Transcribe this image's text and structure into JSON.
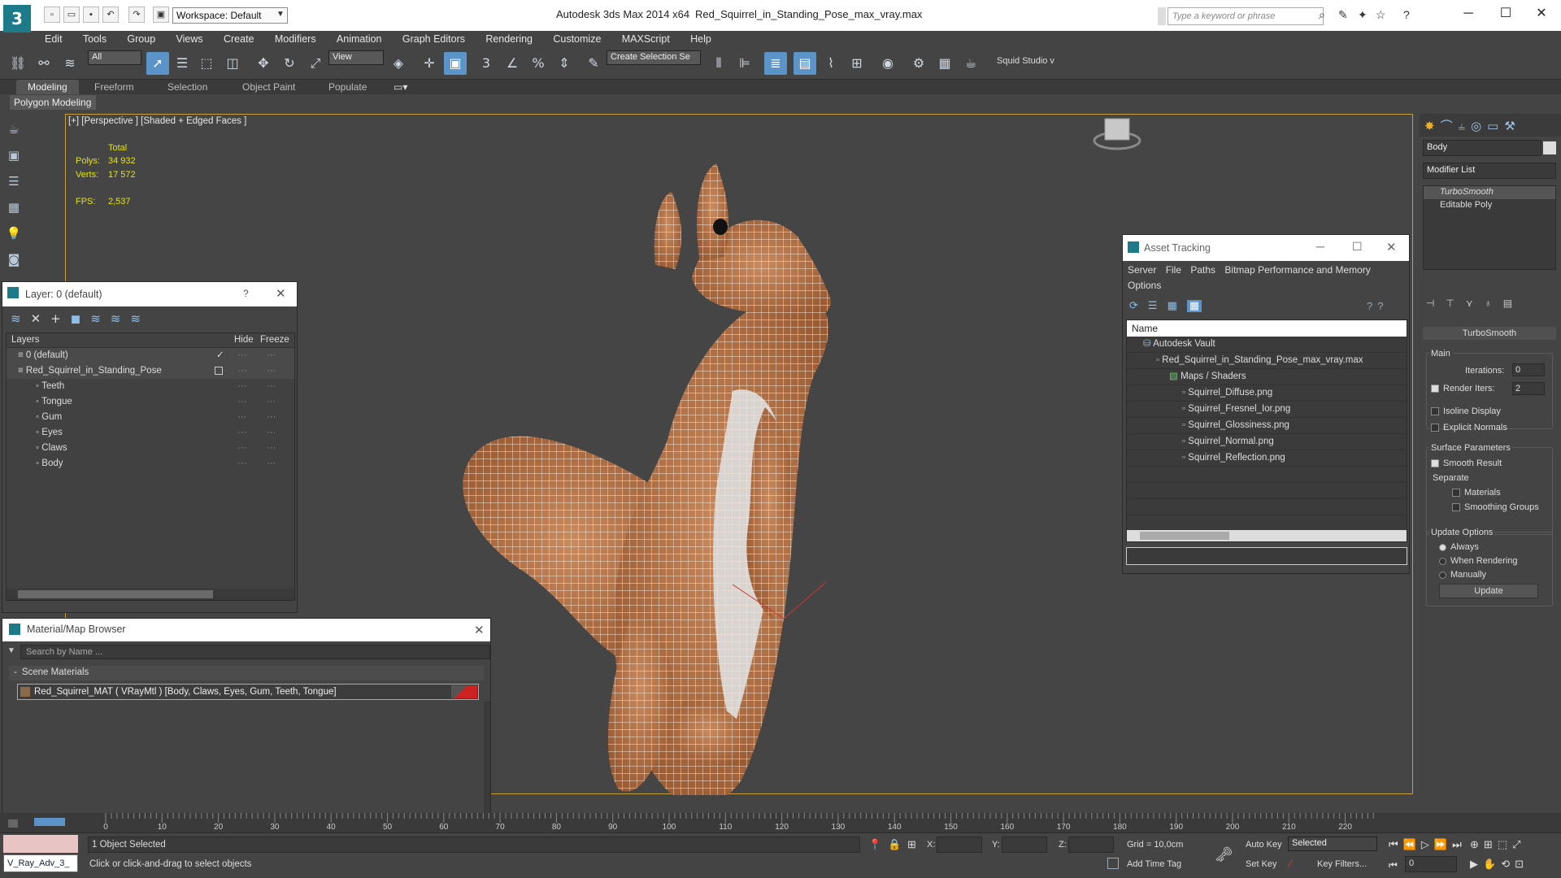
{
  "app": {
    "title": "Autodesk 3ds Max  2014 x64",
    "file": "Red_Squirrel_in_Standing_Pose_max_vray.max",
    "workspace": "Workspace: Default",
    "search_placeholder": "Type a keyword or phrase"
  },
  "menu": [
    "Edit",
    "Tools",
    "Group",
    "Views",
    "Create",
    "Modifiers",
    "Animation",
    "Graph Editors",
    "Rendering",
    "Customize",
    "MAXScript",
    "Help"
  ],
  "toolbar": {
    "filter": "All",
    "ref_coord": "View",
    "selection_set": "Create Selection Se",
    "squid": "Squid Studio v"
  },
  "ribbon": {
    "tabs": [
      "Modeling",
      "Freeform",
      "Selection",
      "Object Paint",
      "Populate"
    ],
    "sub": "Polygon Modeling"
  },
  "viewport": {
    "label": "[+] [Perspective ] [Shaded + Edged Faces ]",
    "stats": {
      "total": "Total",
      "polys_label": "Polys:",
      "polys": "34 932",
      "verts_label": "Verts:",
      "verts": "17 572",
      "fps_label": "FPS:",
      "fps": "2,537"
    }
  },
  "layer_dialog": {
    "title": "Layer: 0 (default)",
    "help": "?",
    "col_layers": "Layers",
    "col_hide": "Hide",
    "col_freeze": "Freeze",
    "rows": [
      {
        "name": "0 (default)",
        "indent": 0
      },
      {
        "name": "Red_Squirrel_in_Standing_Pose",
        "indent": 0
      },
      {
        "name": "Teeth",
        "indent": 1
      },
      {
        "name": "Tongue",
        "indent": 1
      },
      {
        "name": "Gum",
        "indent": 1
      },
      {
        "name": "Eyes",
        "indent": 1
      },
      {
        "name": "Claws",
        "indent": 1
      },
      {
        "name": "Body",
        "indent": 1
      }
    ]
  },
  "material_browser": {
    "title": "Material/Map Browser",
    "search_placeholder": "Search by Name ...",
    "group": "Scene Materials",
    "item": "Red_Squirrel_MAT  ( VRayMtl ) [Body, Claws, Eyes, Gum, Teeth, Tongue]"
  },
  "asset_tracking": {
    "title": "Asset Tracking",
    "menu": [
      "Server",
      "File",
      "Paths",
      "Bitmap Performance and Memory",
      "Options"
    ],
    "col_name": "Name",
    "rows": [
      {
        "name": "Autodesk Vault",
        "indent": 0
      },
      {
        "name": "Red_Squirrel_in_Standing_Pose_max_vray.max",
        "indent": 1
      },
      {
        "name": "Maps / Shaders",
        "indent": 2
      },
      {
        "name": "Squirrel_Diffuse.png",
        "indent": 3
      },
      {
        "name": "Squirrel_Fresnel_Ior.png",
        "indent": 3
      },
      {
        "name": "Squirrel_Glossiness.png",
        "indent": 3
      },
      {
        "name": "Squirrel_Normal.png",
        "indent": 3
      },
      {
        "name": "Squirrel_Reflection.png",
        "indent": 3
      }
    ]
  },
  "command_panel": {
    "object_name": "Body",
    "modifier_list": "Modifier List",
    "stack": [
      "TurboSmooth",
      "Editable Poly"
    ],
    "rollout": "TurboSmooth",
    "main": "Main",
    "iterations_label": "Iterations:",
    "iterations": "0",
    "render_iters_label": "Render Iters:",
    "render_iters": "2",
    "isoline": "Isoline Display",
    "explicit": "Explicit Normals",
    "surface_params": "Surface Parameters",
    "smooth_result": "Smooth Result",
    "separate": "Separate",
    "materials": "Materials",
    "smoothing_groups": "Smoothing Groups",
    "update_options": "Update Options",
    "always": "Always",
    "when_rendering": "When Rendering",
    "manually": "Manually",
    "update_btn": "Update"
  },
  "timeline": {
    "ticks": [
      "0",
      "10",
      "20",
      "30",
      "40",
      "50",
      "60",
      "70",
      "80",
      "90",
      "100",
      "110",
      "120",
      "130",
      "140",
      "150",
      "160",
      "170",
      "180",
      "190",
      "200",
      "210",
      "220"
    ]
  },
  "status": {
    "script": "V_Ray_Adv_3_",
    "selected": "1 Object Selected",
    "prompt": "Click or click-and-drag to select objects",
    "x": "X:",
    "y": "Y:",
    "z": "Z:",
    "grid": "Grid = 10,0cm",
    "add_time_tag": "Add Time Tag",
    "auto_key": "Auto Key",
    "set_key": "Set Key",
    "selected_dd": "Selected",
    "key_filters": "Key Filters...",
    "frame": "0"
  }
}
